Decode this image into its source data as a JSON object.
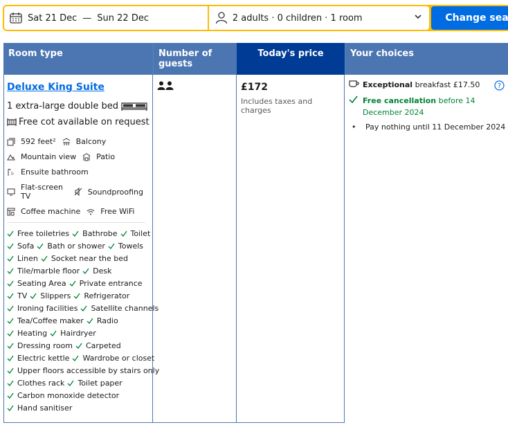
{
  "search": {
    "checkin": "Sat 21 Dec",
    "dash": "—",
    "checkout": "Sun 22 Dec",
    "guests": "2 adults · 0 children · 1 room",
    "button": "Change search"
  },
  "table": {
    "headers": [
      "Room type",
      "Number of guests",
      "Today's price",
      "Your choices"
    ]
  },
  "room": {
    "name": "Deluxe King Suite",
    "bed": "1 extra-large double bed",
    "cot": "Free cot available on request",
    "facility_rows": [
      [
        {
          "icon": "room-size-icon",
          "label": "592 feet²"
        },
        {
          "icon": "balcony-icon",
          "label": "Balcony"
        }
      ],
      [
        {
          "icon": "mountain-icon",
          "label": "Mountain view"
        },
        {
          "icon": "patio-icon",
          "label": "Patio"
        }
      ],
      [
        {
          "icon": "bathroom-icon",
          "label": "Ensuite bathroom"
        }
      ],
      [
        {
          "icon": "tv-icon",
          "label": "Flat-screen TV"
        },
        {
          "icon": "soundproofing-icon",
          "label": "Soundproofing"
        }
      ],
      [
        {
          "icon": "coffee-machine-icon",
          "label": "Coffee machine"
        },
        {
          "icon": "wifi-icon",
          "label": "Free WiFi"
        }
      ]
    ],
    "amenity_rows": [
      [
        "Free toiletries",
        "Bathrobe",
        "Toilet"
      ],
      [
        "Sofa",
        "Bath or shower",
        "Towels"
      ],
      [
        "Linen",
        "Socket near the bed"
      ],
      [
        "Tile/marble floor",
        "Desk"
      ],
      [
        "Seating Area",
        "Private entrance"
      ],
      [
        "TV",
        "Slippers",
        "Refrigerator"
      ],
      [
        "Ironing facilities",
        "Satellite channels"
      ],
      [
        "Tea/Coffee maker",
        "Radio"
      ],
      [
        "Heating",
        "Hairdryer"
      ],
      [
        "Dressing room",
        "Carpeted"
      ],
      [
        "Electric kettle",
        "Wardrobe or closet"
      ],
      [
        "Upper floors accessible by stairs only"
      ],
      [
        "Clothes rack",
        "Toilet paper"
      ],
      [
        "Carbon monoxide detector"
      ],
      [
        "Hand sanitiser"
      ]
    ]
  },
  "price": {
    "amount": "£172",
    "note": "Includes taxes and charges"
  },
  "choices": {
    "breakfast_bold": "Exceptional",
    "breakfast_rest": " breakfast £17.50",
    "cancel_bold": "Free cancellation",
    "cancel_rest": " before 14 December 2024",
    "pay": "Pay nothing until 11 December 2024"
  },
  "colors": {
    "header_blue": "#4c76b2",
    "dark_blue": "#003b95",
    "link_blue": "#006ce4",
    "green": "#008234",
    "yellow": "#febb02"
  }
}
